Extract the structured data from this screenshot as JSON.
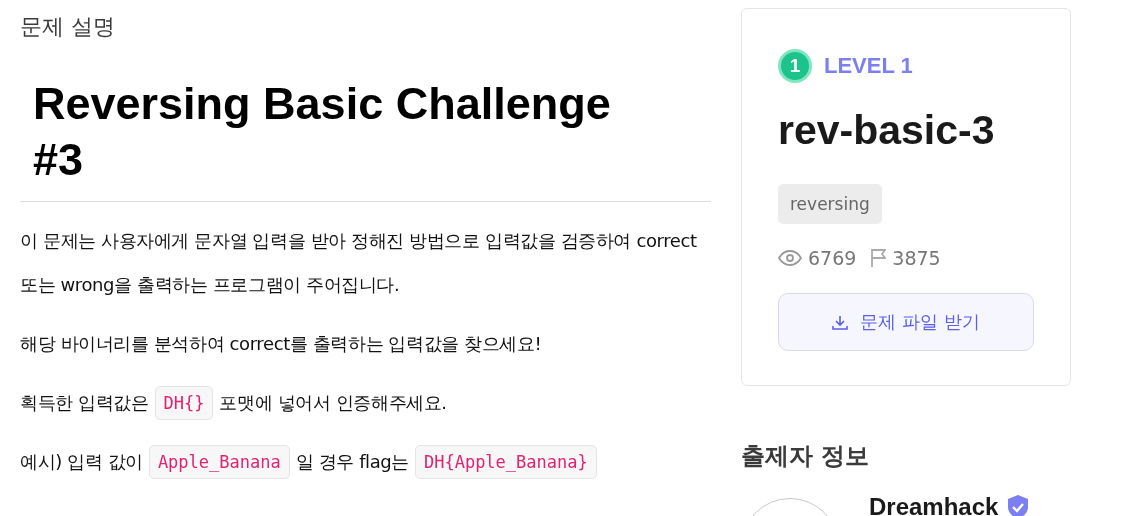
{
  "section_title": "문제 설명",
  "challenge_title": "Reversing Basic Challenge #3",
  "paragraphs": [
    [
      {
        "kind": "text",
        "text": "이 문제는 사용자에게 문자열 입력을 받아 정해진 방법으로 입력값을 검증하여 correct 또는 wrong을 출력하는 프로그램이 주어집니다."
      }
    ],
    [
      {
        "kind": "text",
        "text": "해당 바이너리를 분석하여 correct를 출력하는 입력값을 찾으세요!"
      }
    ],
    [
      {
        "kind": "text",
        "text": "획득한 입력값은"
      },
      {
        "kind": "code",
        "text": "DH{}"
      },
      {
        "kind": "text",
        "text": "포맷에 넣어서 인증해주세요."
      }
    ],
    [
      {
        "kind": "text",
        "text": "예시) 입력 값이"
      },
      {
        "kind": "code",
        "text": "Apple_Banana"
      },
      {
        "kind": "text",
        "text": "일 경우 flag는"
      },
      {
        "kind": "code",
        "text": "DH{Apple_Banana}"
      }
    ]
  ],
  "card": {
    "level_number": "1",
    "level_label": "LEVEL 1",
    "name": "rev-basic-3",
    "tags": [
      "reversing"
    ],
    "views": "6769",
    "solves": "3875",
    "download_button": "문제 파일 받기"
  },
  "author_section": {
    "title": "출제자 정보",
    "name": "Dreamhack",
    "verified": true
  }
}
